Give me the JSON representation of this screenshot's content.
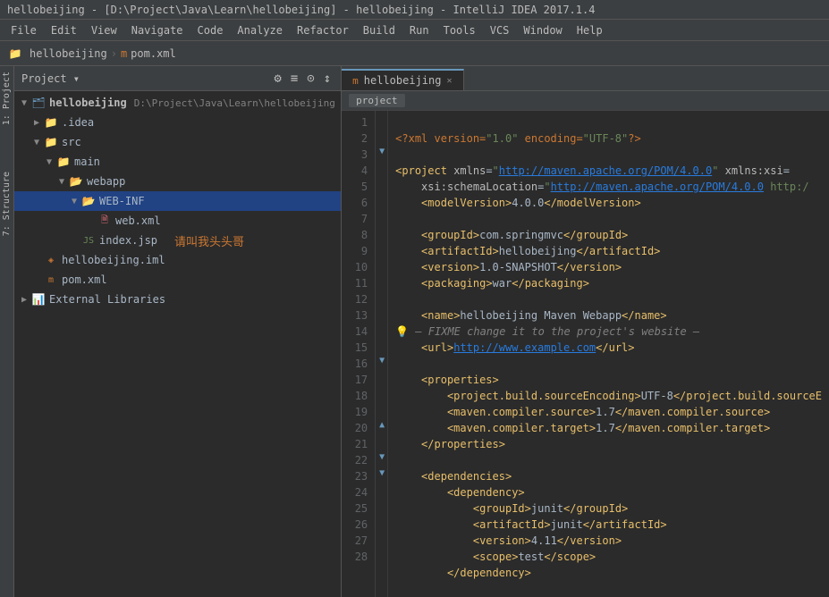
{
  "titleBar": {
    "text": "hellobeijing - [D:\\Project\\Java\\Learn\\hellobeijing] - hellobeijing - IntelliJ IDEA 2017.1.4"
  },
  "menuBar": {
    "items": [
      "File",
      "Edit",
      "View",
      "Navigate",
      "Code",
      "Analyze",
      "Refactor",
      "Build",
      "Run",
      "Tools",
      "VCS",
      "Window",
      "Help"
    ]
  },
  "breadcrumb": {
    "items": [
      "hellobeijing",
      "pom.xml"
    ]
  },
  "projectPanel": {
    "title": "Project",
    "rootLabel": "hellobeijing",
    "rootPath": "D:\\Project\\Java\\Learn\\hellobeijing"
  },
  "editorTab": {
    "label": "hellobeijing",
    "icon": "m"
  },
  "editorBreadcrumb": "project",
  "watermark": "请叫我头头哥",
  "lineNumbers": [
    1,
    2,
    3,
    4,
    5,
    6,
    7,
    8,
    9,
    10,
    11,
    12,
    13,
    14,
    15,
    16,
    17,
    18,
    19,
    20,
    21,
    22,
    23,
    24,
    25,
    26,
    27,
    28
  ],
  "codeLines": [
    {
      "num": 1,
      "content": "<?xml version=\"1.0\" encoding=\"UTF-8\"?>",
      "fold": ""
    },
    {
      "num": 2,
      "content": "",
      "fold": ""
    },
    {
      "num": 3,
      "content": "<project xmlns=\"http://maven.apache.org/POM/4.0.0\" xmlns:xsi=",
      "fold": "open"
    },
    {
      "num": 4,
      "content": "    xsi:schemaLocation=\"http://maven.apache.org/POM/4.0.0 http:/",
      "fold": ""
    },
    {
      "num": 5,
      "content": "    <modelVersion>4.0.0</modelVersion>",
      "fold": ""
    },
    {
      "num": 6,
      "content": "",
      "fold": ""
    },
    {
      "num": 7,
      "content": "    <groupId>com.springmvc</groupId>",
      "fold": ""
    },
    {
      "num": 8,
      "content": "    <artifactId>hellobeijing</artifactId>",
      "fold": ""
    },
    {
      "num": 9,
      "content": "    <version>1.0-SNAPSHOT</version>",
      "fold": ""
    },
    {
      "num": 10,
      "content": "    <packaging>war</packaging>",
      "fold": ""
    },
    {
      "num": 11,
      "content": "",
      "fold": ""
    },
    {
      "num": 12,
      "content": "    <name>hellobeijing Maven Webapp</name>",
      "fold": ""
    },
    {
      "num": 13,
      "content": "    <!-- FIXME change it to the project's website -->",
      "fold": ""
    },
    {
      "num": 14,
      "content": "    <url>http://www.example.com</url>",
      "fold": ""
    },
    {
      "num": 15,
      "content": "",
      "fold": ""
    },
    {
      "num": 16,
      "content": "    <properties>",
      "fold": "open"
    },
    {
      "num": 17,
      "content": "        <project.build.sourceEncoding>UTF-8</project.build.sourceE",
      "fold": ""
    },
    {
      "num": 18,
      "content": "        <maven.compiler.source>1.7</maven.compiler.source>",
      "fold": ""
    },
    {
      "num": 19,
      "content": "        <maven.compiler.target>1.7</maven.compiler.target>",
      "fold": ""
    },
    {
      "num": 20,
      "content": "    </properties>",
      "fold": "close"
    },
    {
      "num": 21,
      "content": "",
      "fold": ""
    },
    {
      "num": 22,
      "content": "    <dependencies>",
      "fold": "open"
    },
    {
      "num": 23,
      "content": "        <dependency>",
      "fold": "open"
    },
    {
      "num": 24,
      "content": "            <groupId>junit</groupId>",
      "fold": ""
    },
    {
      "num": 25,
      "content": "            <artifactId>junit</artifactId>",
      "fold": ""
    },
    {
      "num": 26,
      "content": "            <version>4.11</version>",
      "fold": ""
    },
    {
      "num": 27,
      "content": "            <scope>test</scope>",
      "fold": ""
    },
    {
      "num": 28,
      "content": "        </dependency>",
      "fold": ""
    }
  ]
}
